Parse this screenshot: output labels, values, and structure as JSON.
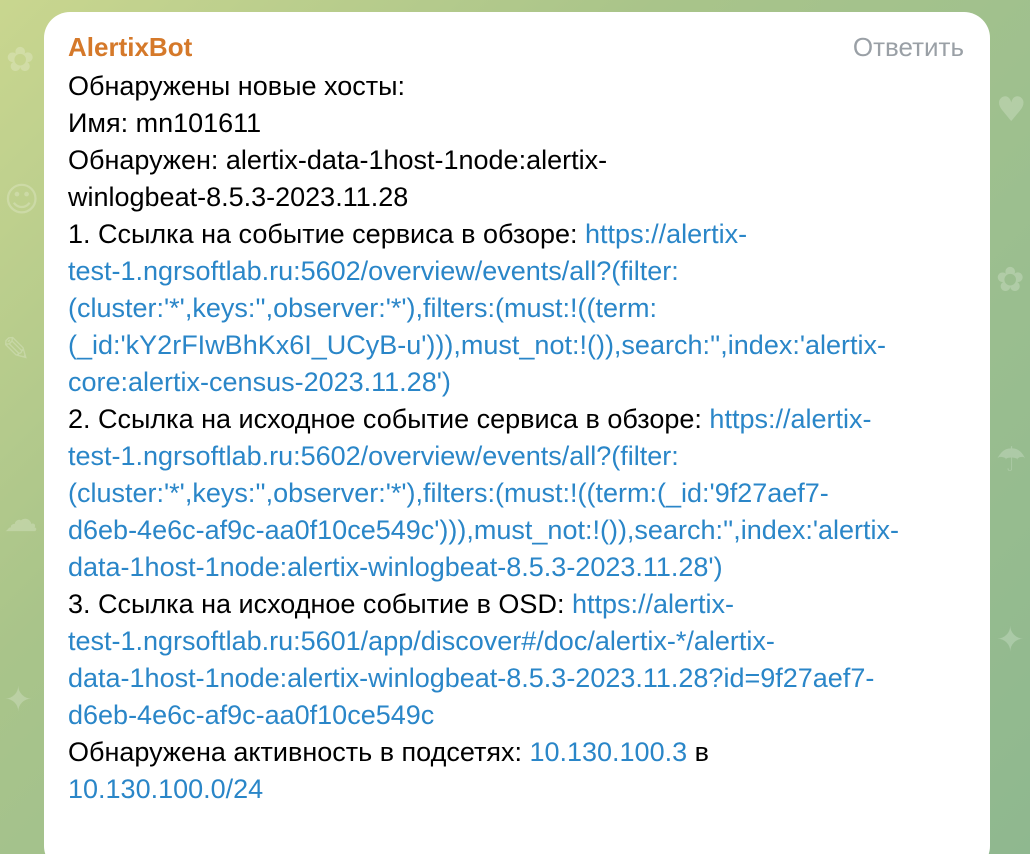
{
  "message": {
    "sender": "AlertixBot",
    "reply_label": "Ответить",
    "lines": {
      "heading": "Обнаружены новые хосты:",
      "name": "Имя: mn101611",
      "detected_line1": "Обнаружен: alertix-data-1host-1node:alertix-",
      "detected_line2": "winlogbeat-8.5.3-2023.11.28",
      "item1_label": "1. Ссылка на событие сервиса в обзоре: ",
      "item1_link_l1": "https://alertix-",
      "item1_link_l2": "test-1.ngrsoftlab.ru:5602/overview/events/all?(filter:",
      "item1_link_l3": "(cluster:'*',keys:'',observer:'*'),filters:(must:!((term:",
      "item1_link_l4": "(_id:'kY2rFIwBhKx6I_UCyB-u'))),must_not:!()),search:'',index:'alertix-",
      "item1_link_l5": "core:alertix-census-2023.11.28')",
      "item2_label": "2. Ссылка на исходное событие сервиса в обзоре: ",
      "item2_link_l1": "https://alertix-",
      "item2_link_l2": "test-1.ngrsoftlab.ru:5602/overview/events/all?(filter:",
      "item2_link_l3": "(cluster:'*',keys:'',observer:'*'),filters:(must:!((term:(_id:'9f27aef7-",
      "item2_link_l4": "d6eb-4e6c-af9c-aa0f10ce549c'))),must_not:!()),search:'',index:'alertix-",
      "item2_link_l5": "data-1host-1node:alertix-winlogbeat-8.5.3-2023.11.28')",
      "item3_label": "3. Ссылка на исходное событие в OSD: ",
      "item3_link_l1": "https://alertix-",
      "item3_link_l2": "test-1.ngrsoftlab.ru:5601/app/discover#/doc/alertix-*/alertix-",
      "item3_link_l3": "data-1host-1node:alertix-winlogbeat-8.5.3-2023.11.28?id=9f27aef7-",
      "item3_link_l4": "d6eb-4e6c-af9c-aa0f10ce549c",
      "activity_label": "Обнаружена активность в подсетях: ",
      "activity_ip": "10.130.100.3",
      "activity_in": " в",
      "activity_subnet": "10.130.100.0/24"
    }
  },
  "colors": {
    "sender": "#d5792a",
    "link": "#2a86c8",
    "reply": "#9aa0a6",
    "bubble": "#ffffff"
  }
}
